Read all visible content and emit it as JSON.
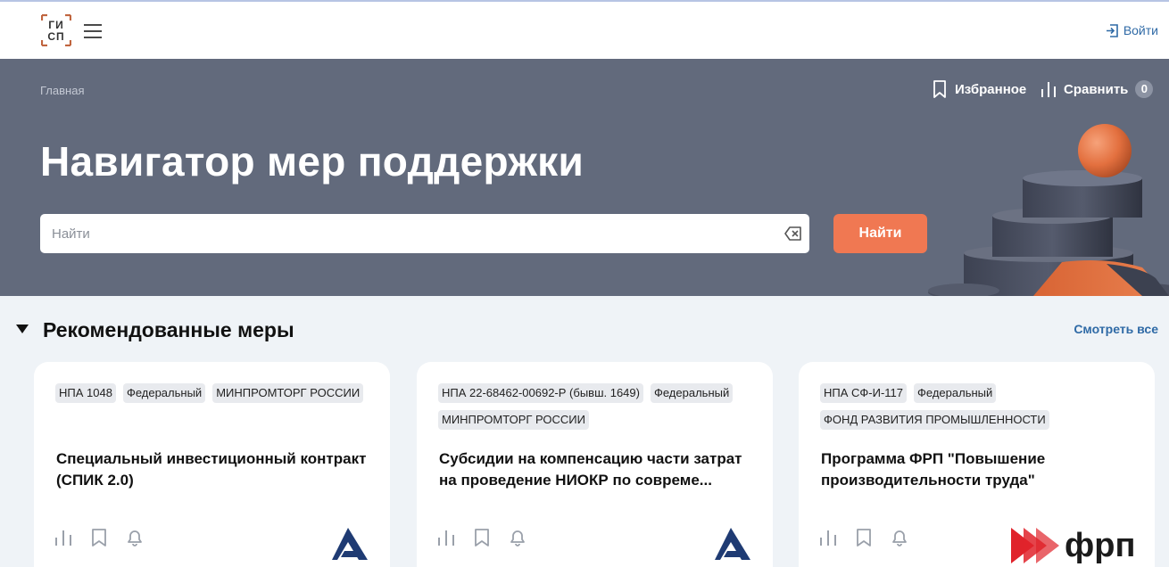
{
  "header": {
    "logo_text": "ГИСП",
    "login_label": "Войти"
  },
  "hero": {
    "breadcrumb": "Главная",
    "favorites_label": "Избранное",
    "compare_label": "Сравнить",
    "compare_count": "0",
    "title": "Навигатор мер поддержки",
    "search_placeholder": "Найти",
    "search_value": "",
    "search_button": "Найти"
  },
  "section": {
    "title": "Рекомендованные меры",
    "see_all": "Смотреть все"
  },
  "cards": [
    {
      "tags": [
        "НПА 1048",
        "Федеральный",
        "МИНПРОМТОРГ РОССИИ"
      ],
      "title": "Специальный инвестиционный контракт (СПИК 2.0)",
      "org_logo": "minpromtorg-logo"
    },
    {
      "tags": [
        "НПА 22-68462-00692-Р (бывш. 1649)",
        "Федеральный",
        "МИНПРОМТОРГ РОССИИ"
      ],
      "title": "Субсидии на компенсацию части затрат на проведение НИОКР по совреме...",
      "org_logo": "minpromtorg-logo"
    },
    {
      "tags": [
        "НПА СФ-И-117",
        "Федеральный",
        "ФОНД РАЗВИТИЯ ПРОМЫШЛЕННОСТИ"
      ],
      "title": "Программа ФРП \"Повышение производительности труда\"",
      "org_logo": "frp-logo",
      "org_logo_text": "фрп"
    }
  ],
  "colors": {
    "hero_bg": "#626a7c",
    "accent_orange": "#f07852",
    "link_blue": "#2f6aa6",
    "page_bg": "#eff3f7",
    "logo_navy": "#1f3b73",
    "frp_red": "#e0232b"
  }
}
